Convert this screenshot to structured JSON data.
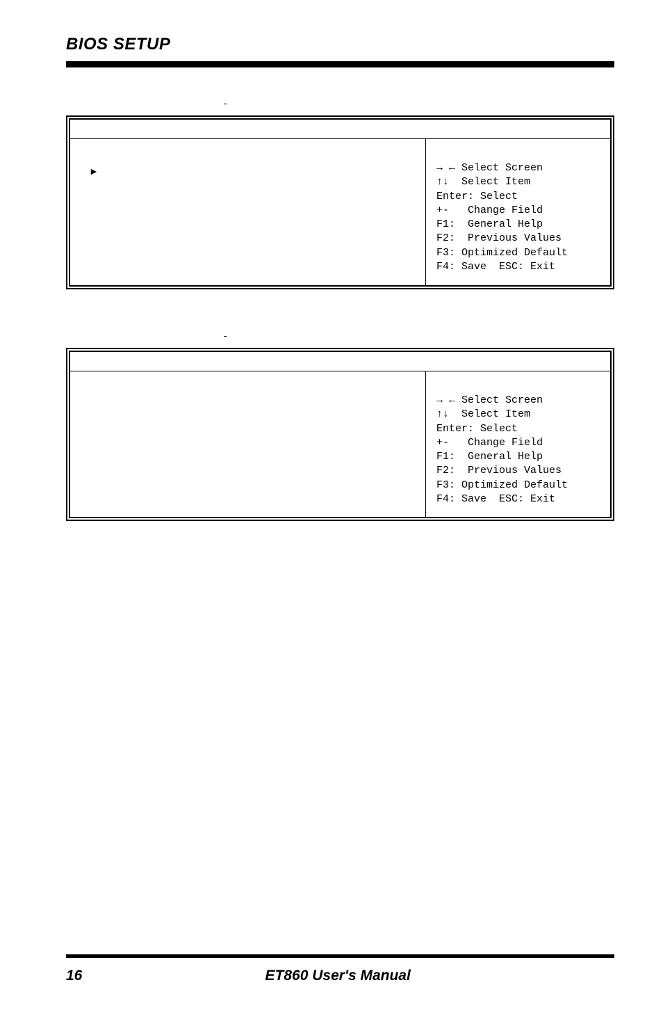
{
  "header": {
    "title": "BIOS SETUP"
  },
  "hyphen": "-",
  "triangle": "►",
  "help": {
    "select_screen": "→ ← Select Screen",
    "select_item": "↑↓  Select Item",
    "enter_select": "Enter: Select",
    "change_field": "+-   Change Field",
    "general_help": "F1:  General Help",
    "prev_values": "F2:  Previous Values",
    "opt_default": "F3: Optimized Default",
    "save_exit": "F4: Save  ESC: Exit"
  },
  "footer": {
    "page": "16",
    "manual": "ET860 User's Manual"
  }
}
